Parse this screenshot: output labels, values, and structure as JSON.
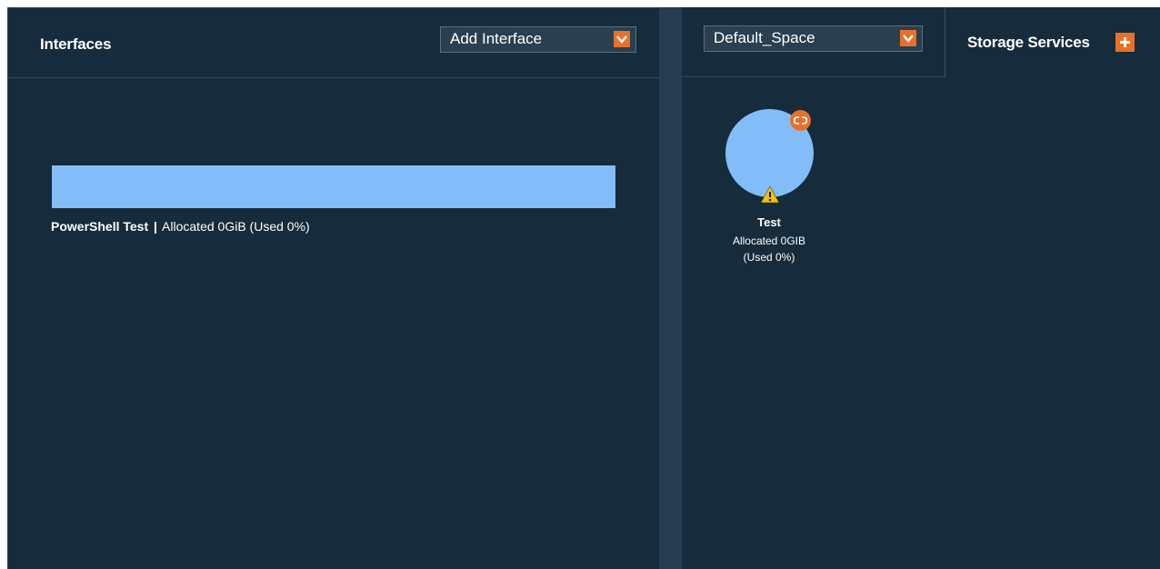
{
  "interfaces": {
    "title": "Interfaces",
    "add_select": {
      "value": "Add Interface"
    },
    "bar": {
      "name": "PowerShell Test",
      "separator": "|",
      "details": "Allocated 0GiB (Used 0%)",
      "used_fraction": 0.0
    }
  },
  "spaces": {
    "select": {
      "value": "Default_Space"
    }
  },
  "storage_services": {
    "label": "Storage Services",
    "add_icon": "plus-icon",
    "items": [
      {
        "name": "Test",
        "allocated": "Allocated 0GIB",
        "used": "(Used 0%)",
        "link_icon": "link-icon",
        "status_icon": "warning-icon"
      }
    ]
  },
  "colors": {
    "background": "#162b3b",
    "divider": "#253d50",
    "accent": "#e8712a",
    "bar": "#83bdf9",
    "warning": "#f2c200"
  }
}
